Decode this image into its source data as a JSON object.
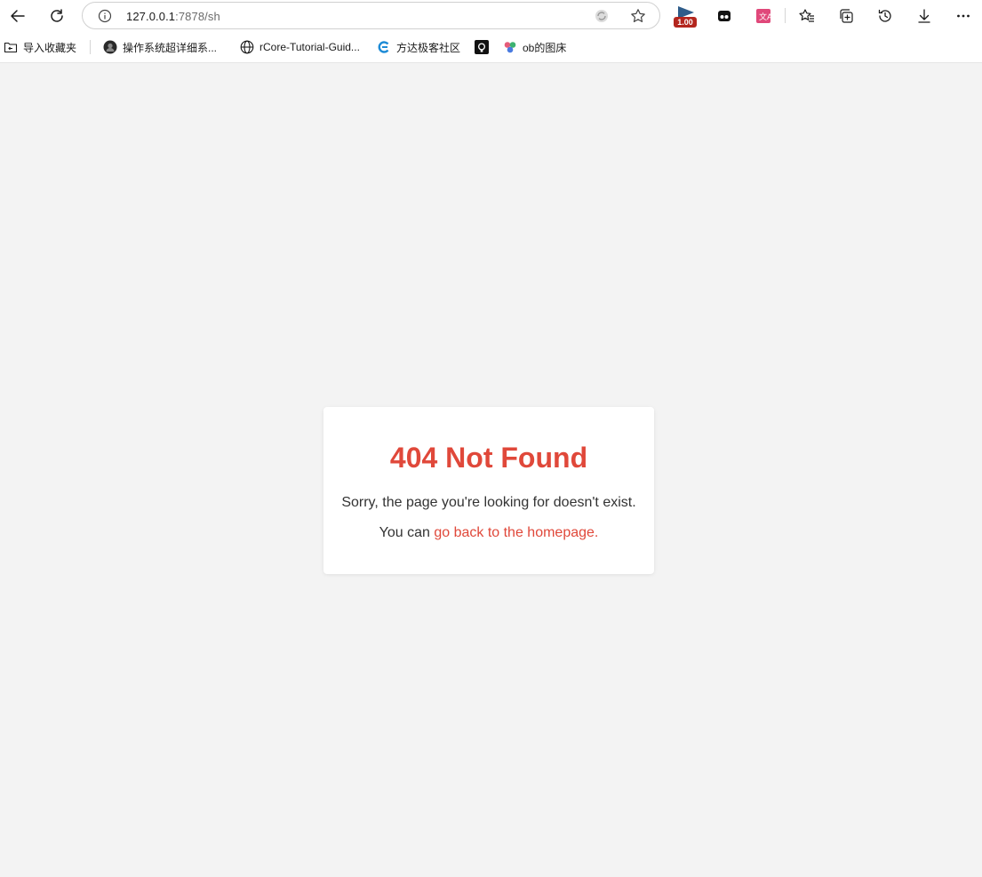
{
  "browser": {
    "address": {
      "host": "127.0.0.1",
      "path": ":7878/sh"
    },
    "extension_badge": "1.00",
    "bookmarks": [
      {
        "label": "导入收藏夹",
        "icon": "folder-icon"
      },
      {
        "label": "操作系统超详细系...",
        "icon": "site-icon"
      },
      {
        "label": "rCore-Tutorial-Guid...",
        "icon": "globe-icon"
      },
      {
        "label": "方达极客社区",
        "icon": "site-icon"
      },
      {
        "label": "",
        "icon": "github-icon"
      },
      {
        "label": "ob的图床",
        "icon": "site-icon"
      }
    ]
  },
  "page": {
    "heading": "404 Not Found",
    "message": "Sorry, the page you're looking for doesn't exist.",
    "prompt": "You can ",
    "link_text": "go back to the homepage.",
    "accent_color": "#e0483a",
    "background_color": "#f3f3f3"
  }
}
